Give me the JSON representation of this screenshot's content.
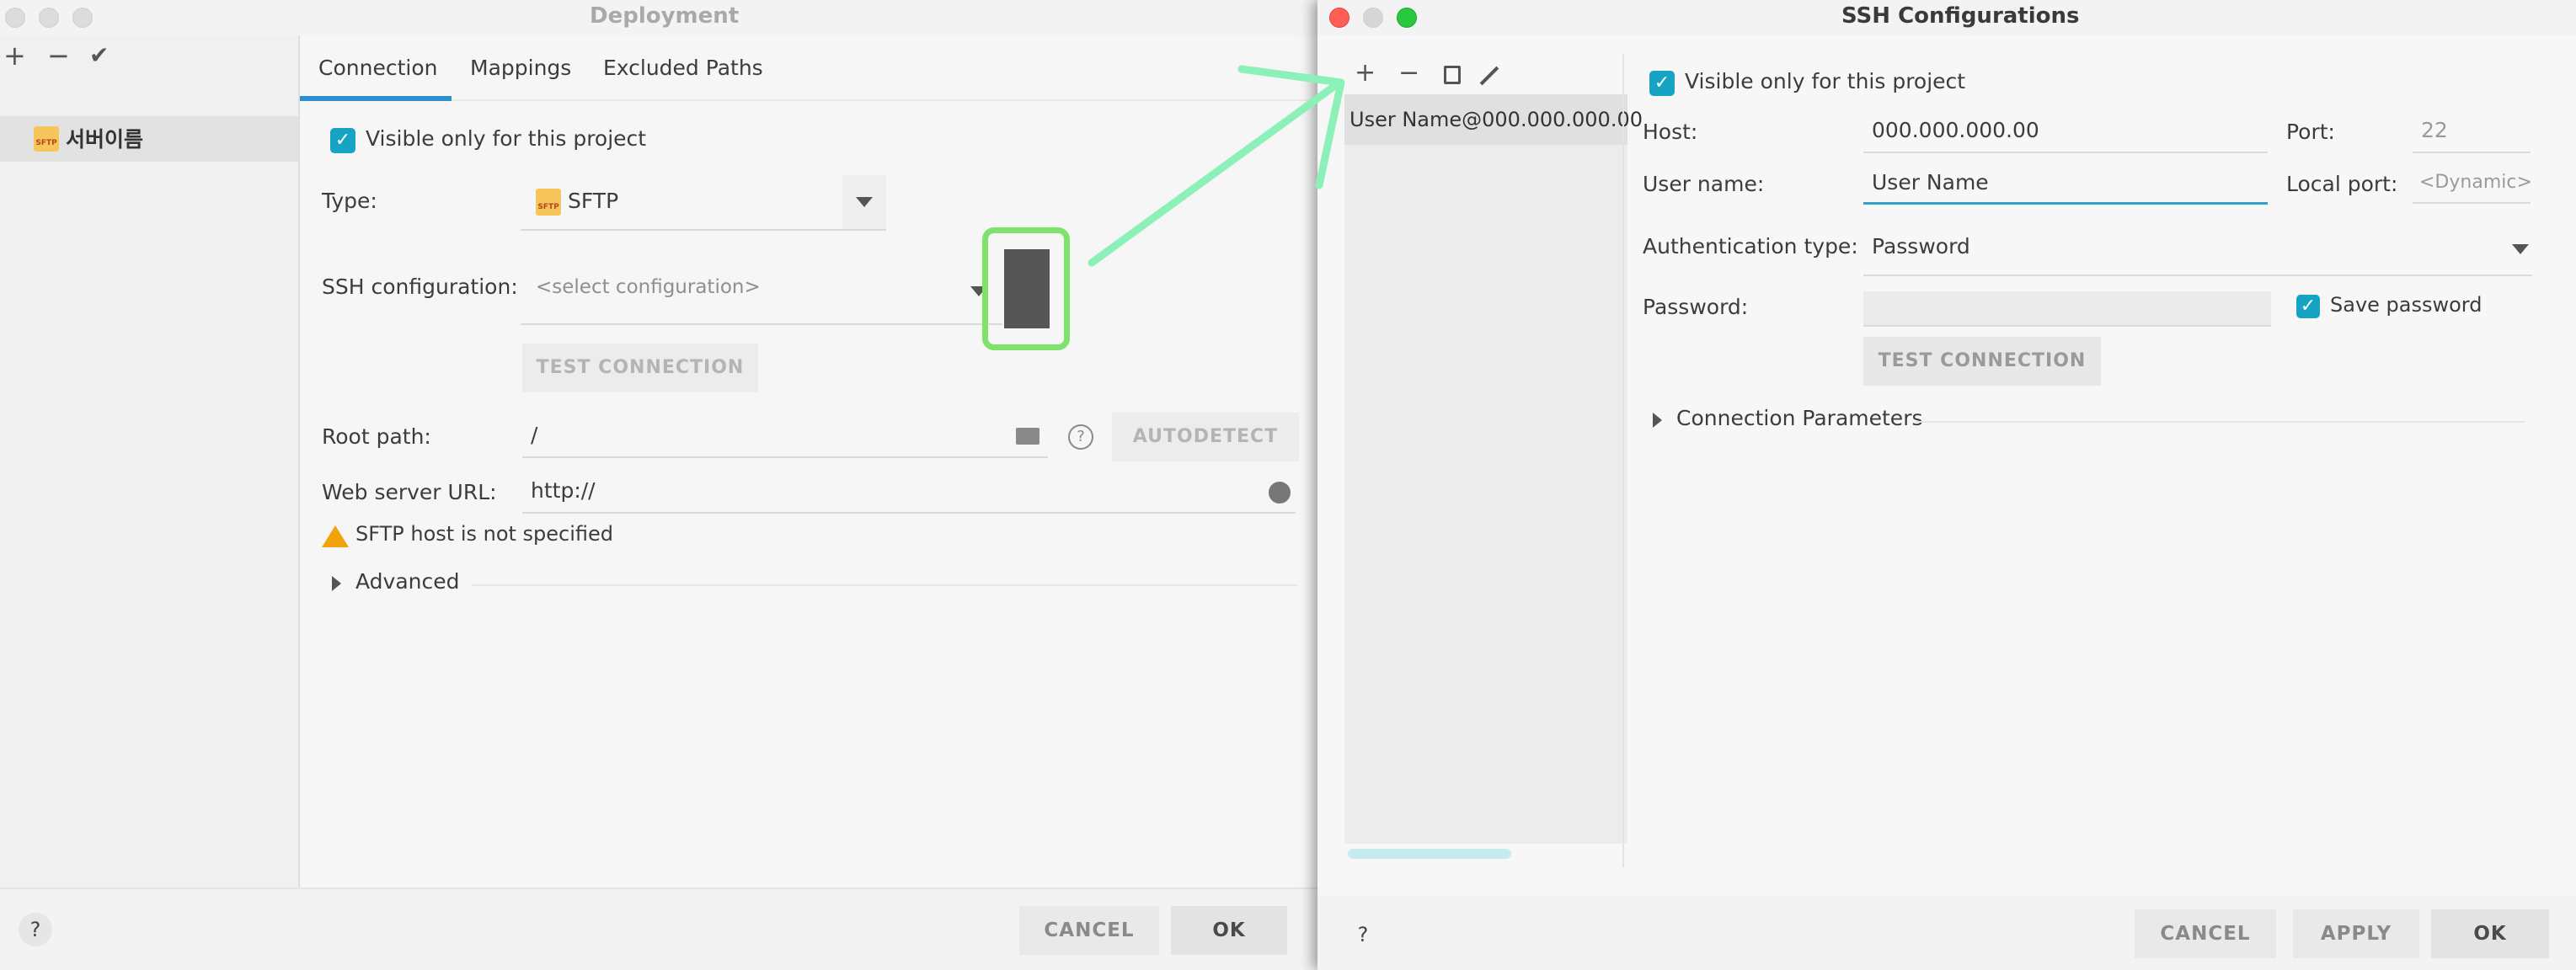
{
  "deployment": {
    "title": "Deployment",
    "toolbar": {
      "add": "+",
      "remove": "−",
      "apply": "✔"
    },
    "server_name": "서버이름",
    "tabs": [
      "Connection",
      "Mappings",
      "Excluded Paths"
    ],
    "visible_only_label": "Visible only for this project",
    "type_label": "Type:",
    "type_value": "SFTP",
    "sftp_badge": "SFTP",
    "ssh_config_label": "SSH configuration:",
    "ssh_config_placeholder": "<select configuration>",
    "test_connection": "TEST CONNECTION",
    "root_path_label": "Root path:",
    "root_path_value": "/",
    "autodetect": "AUTODETECT",
    "web_url_label": "Web server URL:",
    "web_url_value": "http://",
    "warning_text": "SFTP host is not specified",
    "advanced": "Advanced",
    "help": "?",
    "cancel": "CANCEL",
    "ok": "OK"
  },
  "ssh": {
    "title": "SSH Configurations",
    "list_item": "User Name@000.000.000.00",
    "visible_only_label": "Visible only for this project",
    "host_label": "Host:",
    "host_value": "000.000.000.00",
    "port_label": "Port:",
    "port_value": "22",
    "user_label": "User name:",
    "user_value": "User Name",
    "local_port_label": "Local port:",
    "local_port_value": "<Dynamic>",
    "auth_label": "Authentication type:",
    "auth_value": "Password",
    "password_label": "Password:",
    "save_password": "Save password",
    "test_connection": "TEST CONNECTION",
    "connection_params": "Connection Parameters",
    "help": "?",
    "cancel": "CANCEL",
    "apply": "APPLY",
    "ok": "OK"
  },
  "colors": {
    "accent": "#17a3c4",
    "tab_active": "#2c8fcc",
    "annotation_green": "#8cf1b8",
    "annotation_highlight": "#7fe36b",
    "warning": "#f0a30a",
    "close_red": "#ff5f57",
    "minimize_gray": "#d6d6d6",
    "zoom_green": "#28c840"
  }
}
